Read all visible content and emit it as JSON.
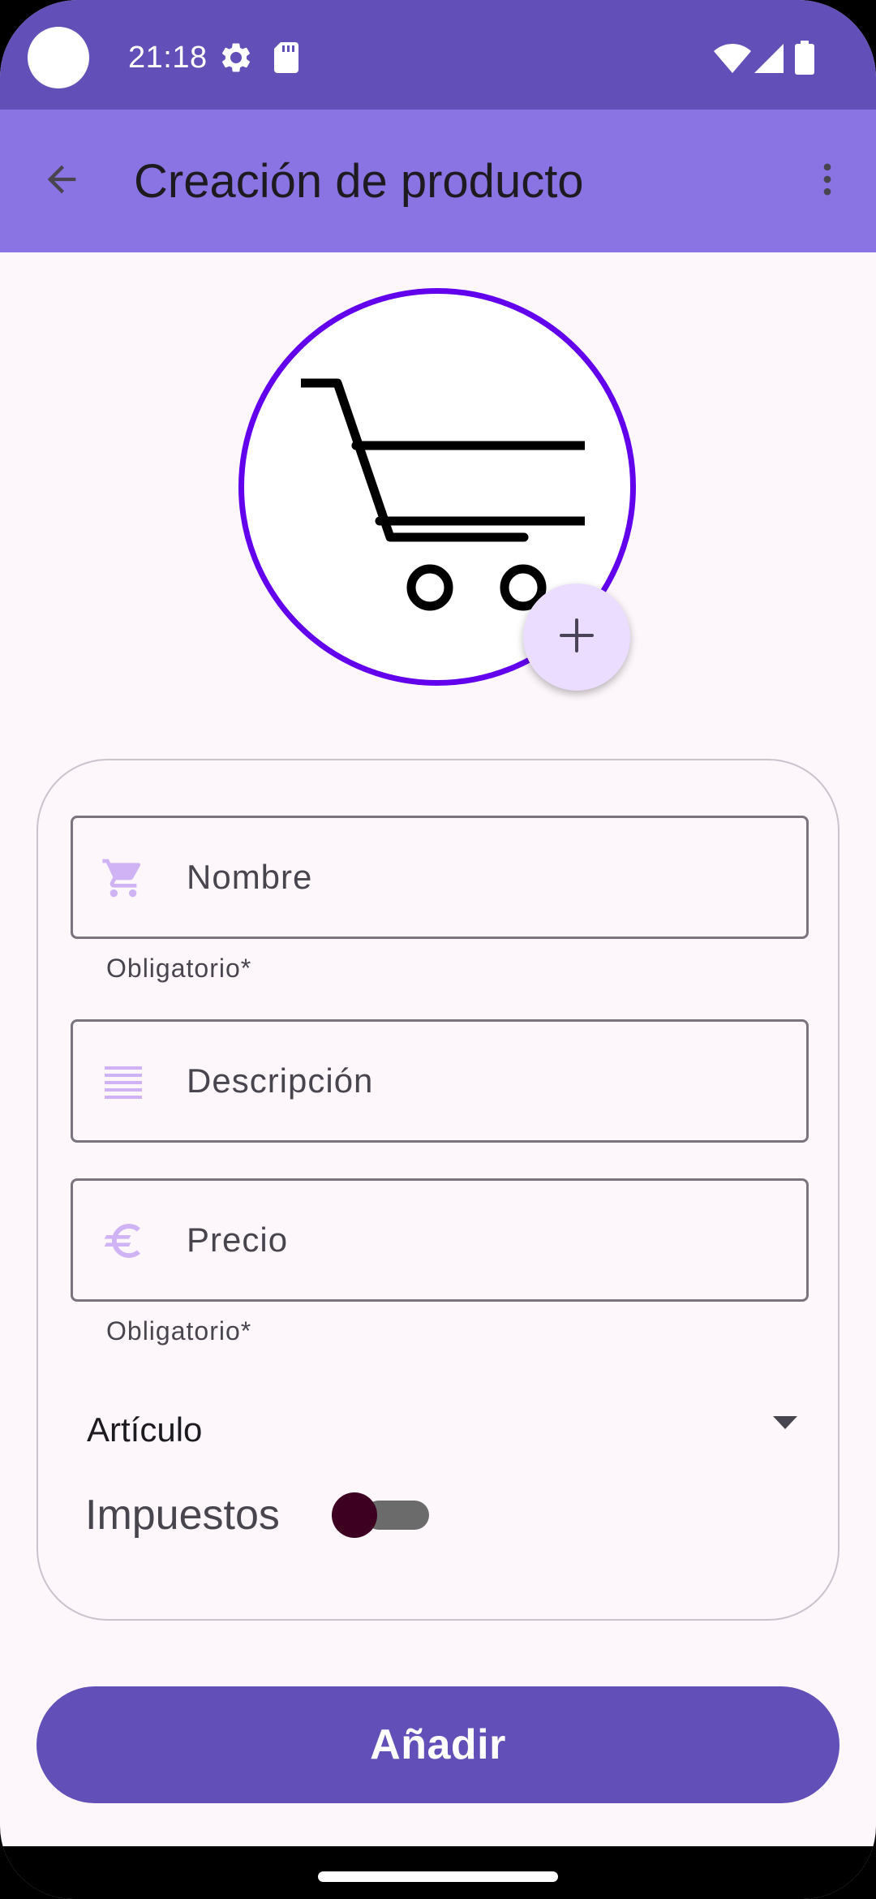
{
  "status_bar": {
    "time": "21:18",
    "icons": [
      "settings-gear-icon",
      "sd-card-icon",
      "wifi-icon",
      "cell-signal-icon",
      "battery-icon"
    ]
  },
  "app_bar": {
    "title": "Creación de producto",
    "back_icon": "arrow-back-icon",
    "menu_icon": "more-vertical-icon"
  },
  "product_image": {
    "icon": "shopping-cart-icon",
    "add_icon": "plus-icon"
  },
  "form": {
    "name": {
      "placeholder": "Nombre",
      "value": "",
      "icon": "shopping-cart-icon",
      "helper": "Obligatorio*"
    },
    "description": {
      "placeholder": "Descripción",
      "value": "",
      "icon": "notes-lines-icon"
    },
    "price": {
      "placeholder": "Precio",
      "value": "",
      "icon": "euro-icon",
      "helper": "Obligatorio*"
    },
    "type": {
      "selected": "Artículo",
      "icon": "dropdown-arrow-icon"
    },
    "taxes": {
      "label": "Impuestos",
      "enabled": false
    }
  },
  "actions": {
    "add_label": "Añadir"
  },
  "colors": {
    "status_bar": "#634fb8",
    "app_bar": "#8a74e3",
    "accent_border": "#6200ee",
    "field_icon": "#cfb3f5",
    "primary_button": "#634fb8",
    "switch_thumb": "#3e0021"
  }
}
